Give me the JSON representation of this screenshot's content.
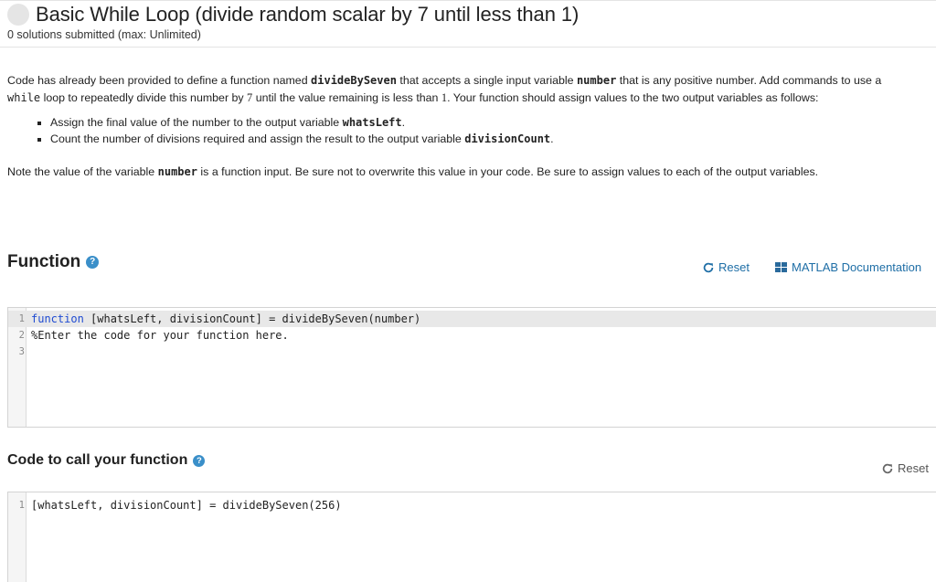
{
  "problem": {
    "title": "Basic While Loop (divide random scalar by 7 until less than 1)",
    "submissions": "0 solutions submitted (max: Unlimited)"
  },
  "description": {
    "p1_a": "Code has already been provided to define a function named ",
    "p1_fn": "divideBySeven",
    "p1_b": " that accepts a single input variable ",
    "p1_var": "number",
    "p1_c": " that is any positive number. Add commands to use a ",
    "p1_while": "while",
    "p1_d": " loop to repeatedly divide this number by ",
    "p1_seven": "7",
    "p1_e": " until the value remaining is less than ",
    "p1_one": "1",
    "p1_f": ". Your function should assign values to the two output variables as follows:",
    "bullets": [
      {
        "text": "Assign the final value of the number to the output variable ",
        "code": "whatsLeft",
        "end": "."
      },
      {
        "text": "Count the number of divisions required and assign the result to the output variable ",
        "code": "divisionCount",
        "end": "."
      }
    ],
    "note_a": "Note the value of the variable ",
    "note_var": "number",
    "note_b": " is a function input. Be sure not to overwrite this value in your code. Be sure to assign values to each of the output variables."
  },
  "function_section": {
    "title": "Function",
    "reset_label": "Reset",
    "doc_label": "MATLAB Documentation",
    "lines": [
      {
        "num": "1",
        "kw": "function",
        "rest": " [whatsLeft, divisionCount] = divideBySeven(number)"
      },
      {
        "num": "2",
        "comment": "%Enter the code for your function here."
      },
      {
        "num": "3",
        "text": ""
      }
    ]
  },
  "call_section": {
    "title": "Code to call your function",
    "reset_label": "Reset",
    "lines": [
      {
        "num": "1",
        "text": "[whatsLeft, divisionCount] = divideBySeven(256)"
      }
    ]
  },
  "icons": {
    "help": "question-circle-icon",
    "reset": "refresh-icon",
    "doc": "book-icon"
  },
  "colors": {
    "link": "#1e6ea6",
    "help_icon": "#3a8fc9",
    "keyword": "#1f4bd2",
    "comment": "#2a8a2a"
  }
}
